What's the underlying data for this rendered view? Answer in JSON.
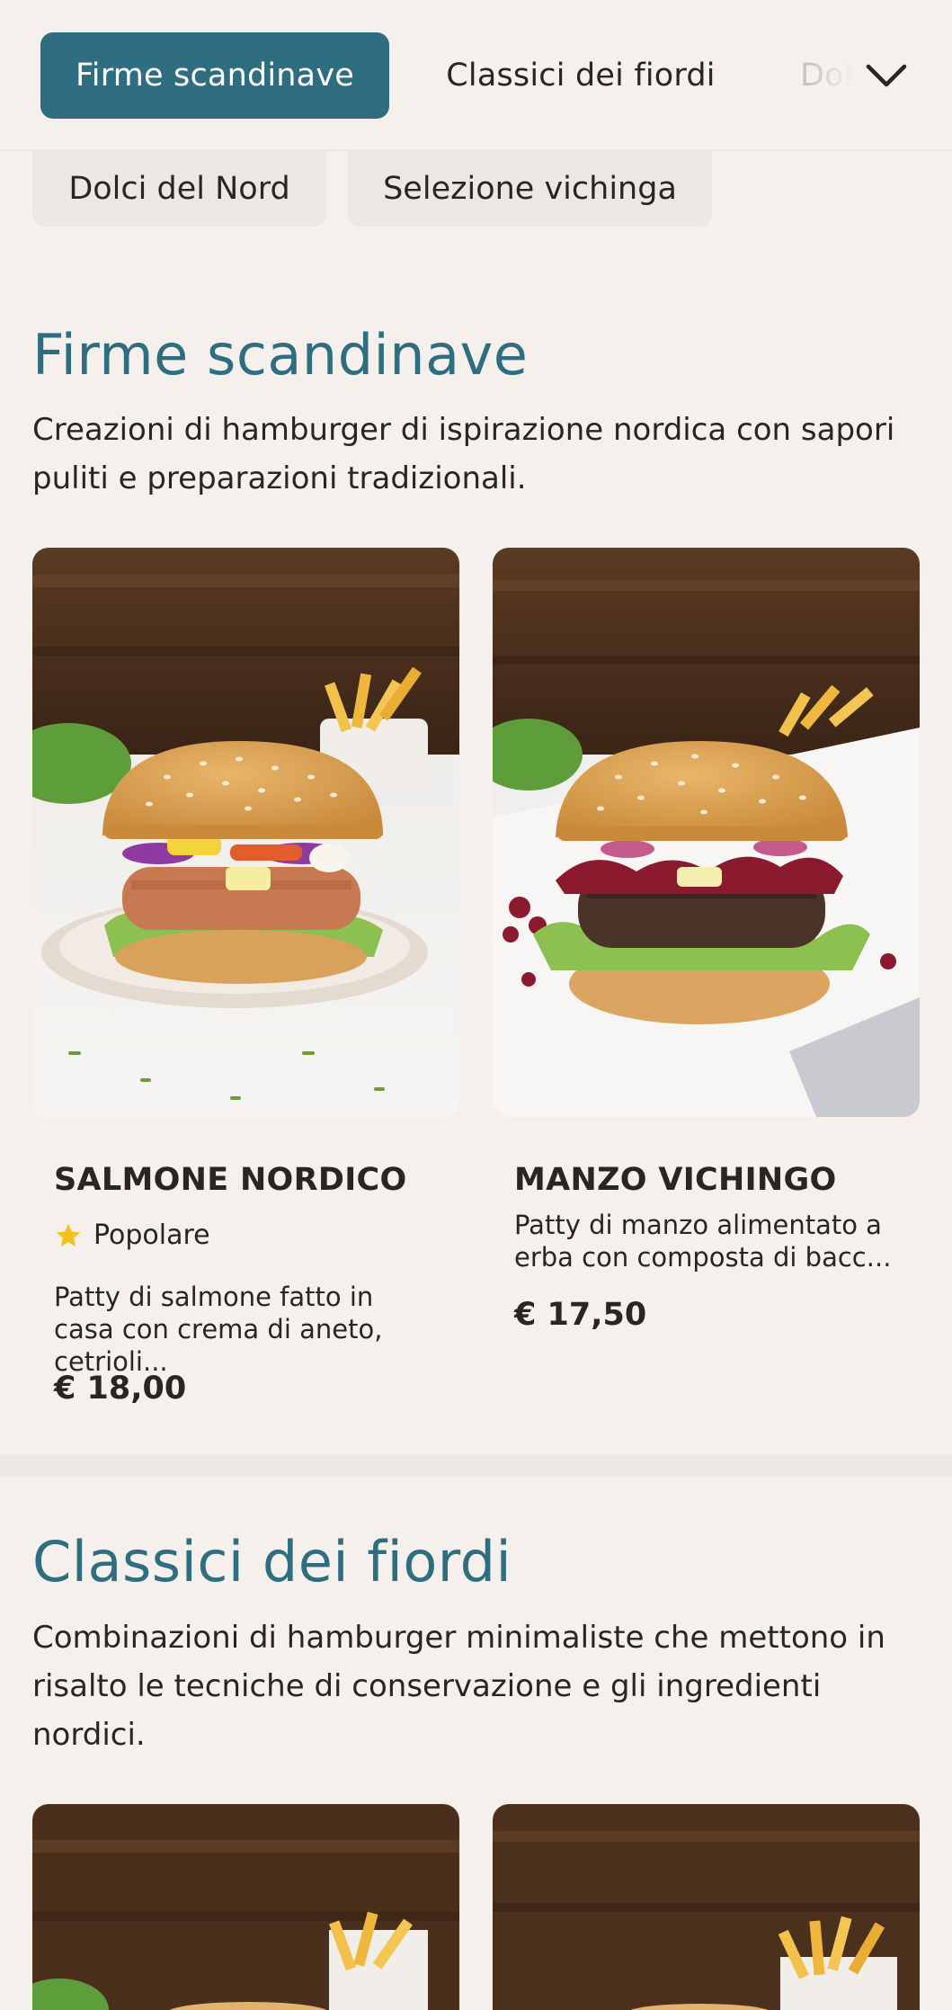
{
  "category_bar": {
    "active": "Firme scandinave",
    "second": "Classici dei fiordi",
    "third_partial": "Dolci del Nord",
    "expand_icon": "chevron-down-icon"
  },
  "category_row2": [
    "Dolci del Nord",
    "Selezione vichinga"
  ],
  "sections": [
    {
      "title": "Firme scandinave",
      "description": "Creazioni di hamburger di ispirazione nordica con sapori puliti e preparazioni tradizionali.",
      "items": [
        {
          "name": "SALMONE NORDICO",
          "badge": "Popolare",
          "badge_icon": "star-icon",
          "description": "Patty di salmone fatto in casa con crema di aneto, cetrioli...",
          "price": "€ 18,00"
        },
        {
          "name": "MANZO VICHINGO",
          "description": "Patty di manzo alimentato a erba con composta di bacc...",
          "price": "€ 17,50"
        }
      ]
    },
    {
      "title": "Classici dei fiordi",
      "description": "Combinazioni di hamburger minimaliste che mettono in risalto le tecniche di conservazione e gli ingredienti nordici."
    }
  ],
  "colors": {
    "accent": "#2e6e80",
    "background": "#f5f0ec",
    "pill": "#ebe8e3",
    "star": "#f2c11c"
  }
}
